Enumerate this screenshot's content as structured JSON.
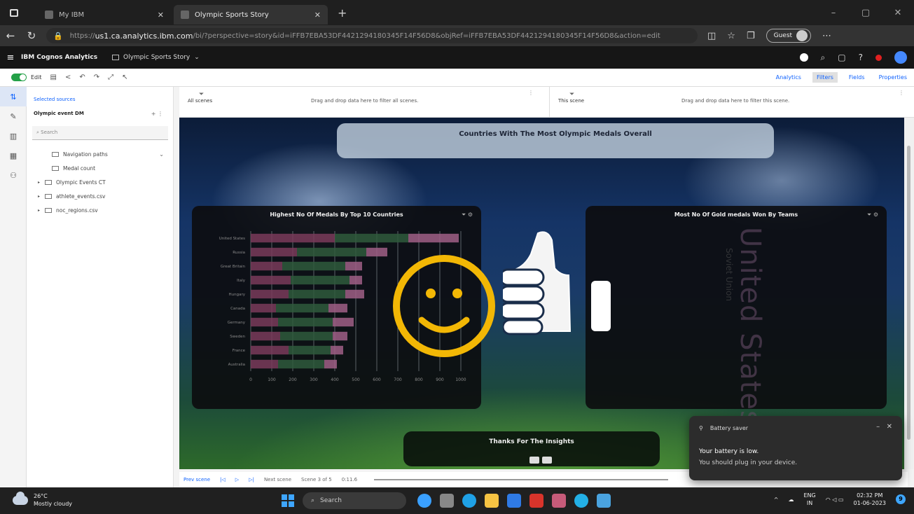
{
  "browser": {
    "tabs": [
      {
        "label": "My IBM"
      },
      {
        "label": "Olympic Sports Story"
      }
    ],
    "url_prefix": "https://",
    "url_host": "us1.ca.analytics.ibm.com",
    "url_rest": "/bi/?perspective=story&id=iFFB7EBA53DF4421294180345F14F56D8&objRef=iFFB7EBA53DF4421294180345F14F56D8&action=edit",
    "guest_label": "Guest"
  },
  "cognos": {
    "app_title": "IBM Cognos Analytics",
    "story_tab": "Olympic Sports Story"
  },
  "toolbar": {
    "edit_label": "Edit",
    "panel_tabs": [
      "Analytics",
      "Filters",
      "Fields",
      "Properties"
    ],
    "selected_panel_tab": "Filters"
  },
  "data_panel": {
    "crumb": "Selected sources",
    "source_name": "Olympic event DM",
    "search_placeholder": "Search",
    "tree": [
      {
        "label": "Navigation paths",
        "level": "sub",
        "expandable": false
      },
      {
        "label": "Medal count",
        "level": "sub",
        "expandable": false
      },
      {
        "label": "Olympic Events CT",
        "level": "top",
        "expandable": true
      },
      {
        "label": "athlete_events.csv",
        "level": "top",
        "expandable": true
      },
      {
        "label": "noc_regions.csv",
        "level": "top",
        "expandable": true
      }
    ]
  },
  "filters": {
    "all_scenes_label": "All scenes",
    "all_scenes_hint": "Drag and drop data here to filter all scenes.",
    "this_scene_label": "This scene",
    "this_scene_hint": "Drag and drop data here to filter this scene."
  },
  "canvas": {
    "banner_title": "Countries With The Most Olympic Medals Overall",
    "chart1_title": "Highest No Of Medals By Top 10 Countries",
    "chart2_title": "Most No Of Gold medals Won By Teams",
    "thanks_title": "Thanks For The Insights",
    "wordcloud_big": "United States",
    "wordcloud_small": "Soviet Union"
  },
  "chart_data": {
    "type": "bar",
    "orientation": "horizontal",
    "stacked": true,
    "categories": [
      "United States",
      "Russia",
      "Great Britain",
      "Italy",
      "Hungary",
      "Canada",
      "Germany",
      "Sweden",
      "France",
      "Australia"
    ],
    "series": [
      {
        "values": [
          4,
          2.2,
          1.5,
          1.9,
          1.8,
          1.2,
          1.3,
          1.4,
          1.8,
          1.3
        ]
      },
      {
        "values": [
          3.5,
          3.3,
          3,
          2.8,
          2.7,
          2.5,
          2.6,
          2.5,
          2,
          2.2
        ]
      },
      {
        "values": [
          2.4,
          1,
          0.8,
          0.6,
          0.9,
          0.9,
          1,
          0.7,
          0.6,
          0.6
        ]
      }
    ],
    "x_ticks": [
      "0",
      "100",
      "200",
      "300",
      "400",
      "500",
      "600",
      "700",
      "800",
      "900",
      "1000"
    ],
    "colors": [
      "#7a3b5b",
      "#2f5a3c",
      "#a05f86"
    ],
    "grid": true
  },
  "scene_nav": {
    "prev": "Prev scene",
    "next": "Next scene",
    "scene_count": "Scene 3 of 5",
    "time": "0:11.6"
  },
  "toast": {
    "app": "Battery saver",
    "title": "Your battery is low.",
    "body": "You should plug in your device."
  },
  "taskbar": {
    "temp": "26°C",
    "weather": "Mostly cloudy",
    "search": "Search",
    "lang1": "ENG",
    "lang2": "IN",
    "time": "02:32 PM",
    "date": "01-06-2023",
    "notifications": "9"
  },
  "colors": {
    "accent": "#0f62fe",
    "smiley": "#f2b705",
    "toggle": "#24a148"
  }
}
